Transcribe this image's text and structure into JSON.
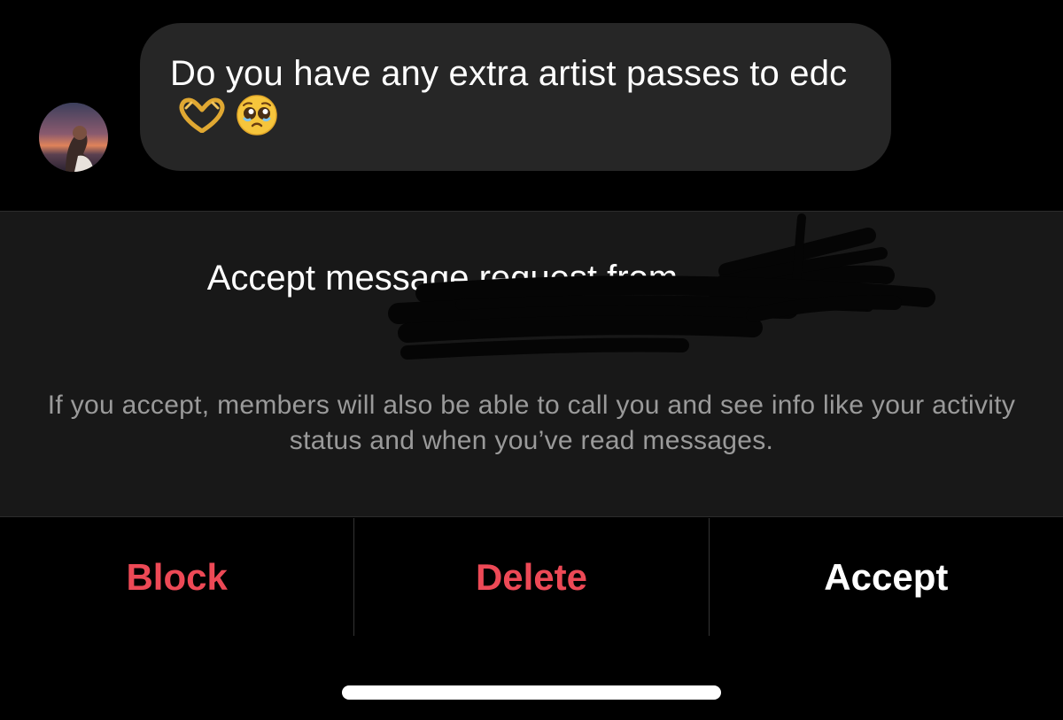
{
  "message": {
    "text": "Do you have any extra artist passes to edc",
    "emojis": [
      "heart-hands-emoji",
      "pleading-face-emoji"
    ]
  },
  "request": {
    "title": "Accept message request from",
    "description": "If you accept, members will also be able to call you and see info like your activity status and when you’ve read messages."
  },
  "actions": {
    "block_label": "Block",
    "delete_label": "Delete",
    "accept_label": "Accept"
  },
  "colors": {
    "background": "#000000",
    "bubble": "#262626",
    "panel": "#181818",
    "destructive": "#ed4956",
    "secondary_text": "#9a9a9a"
  }
}
